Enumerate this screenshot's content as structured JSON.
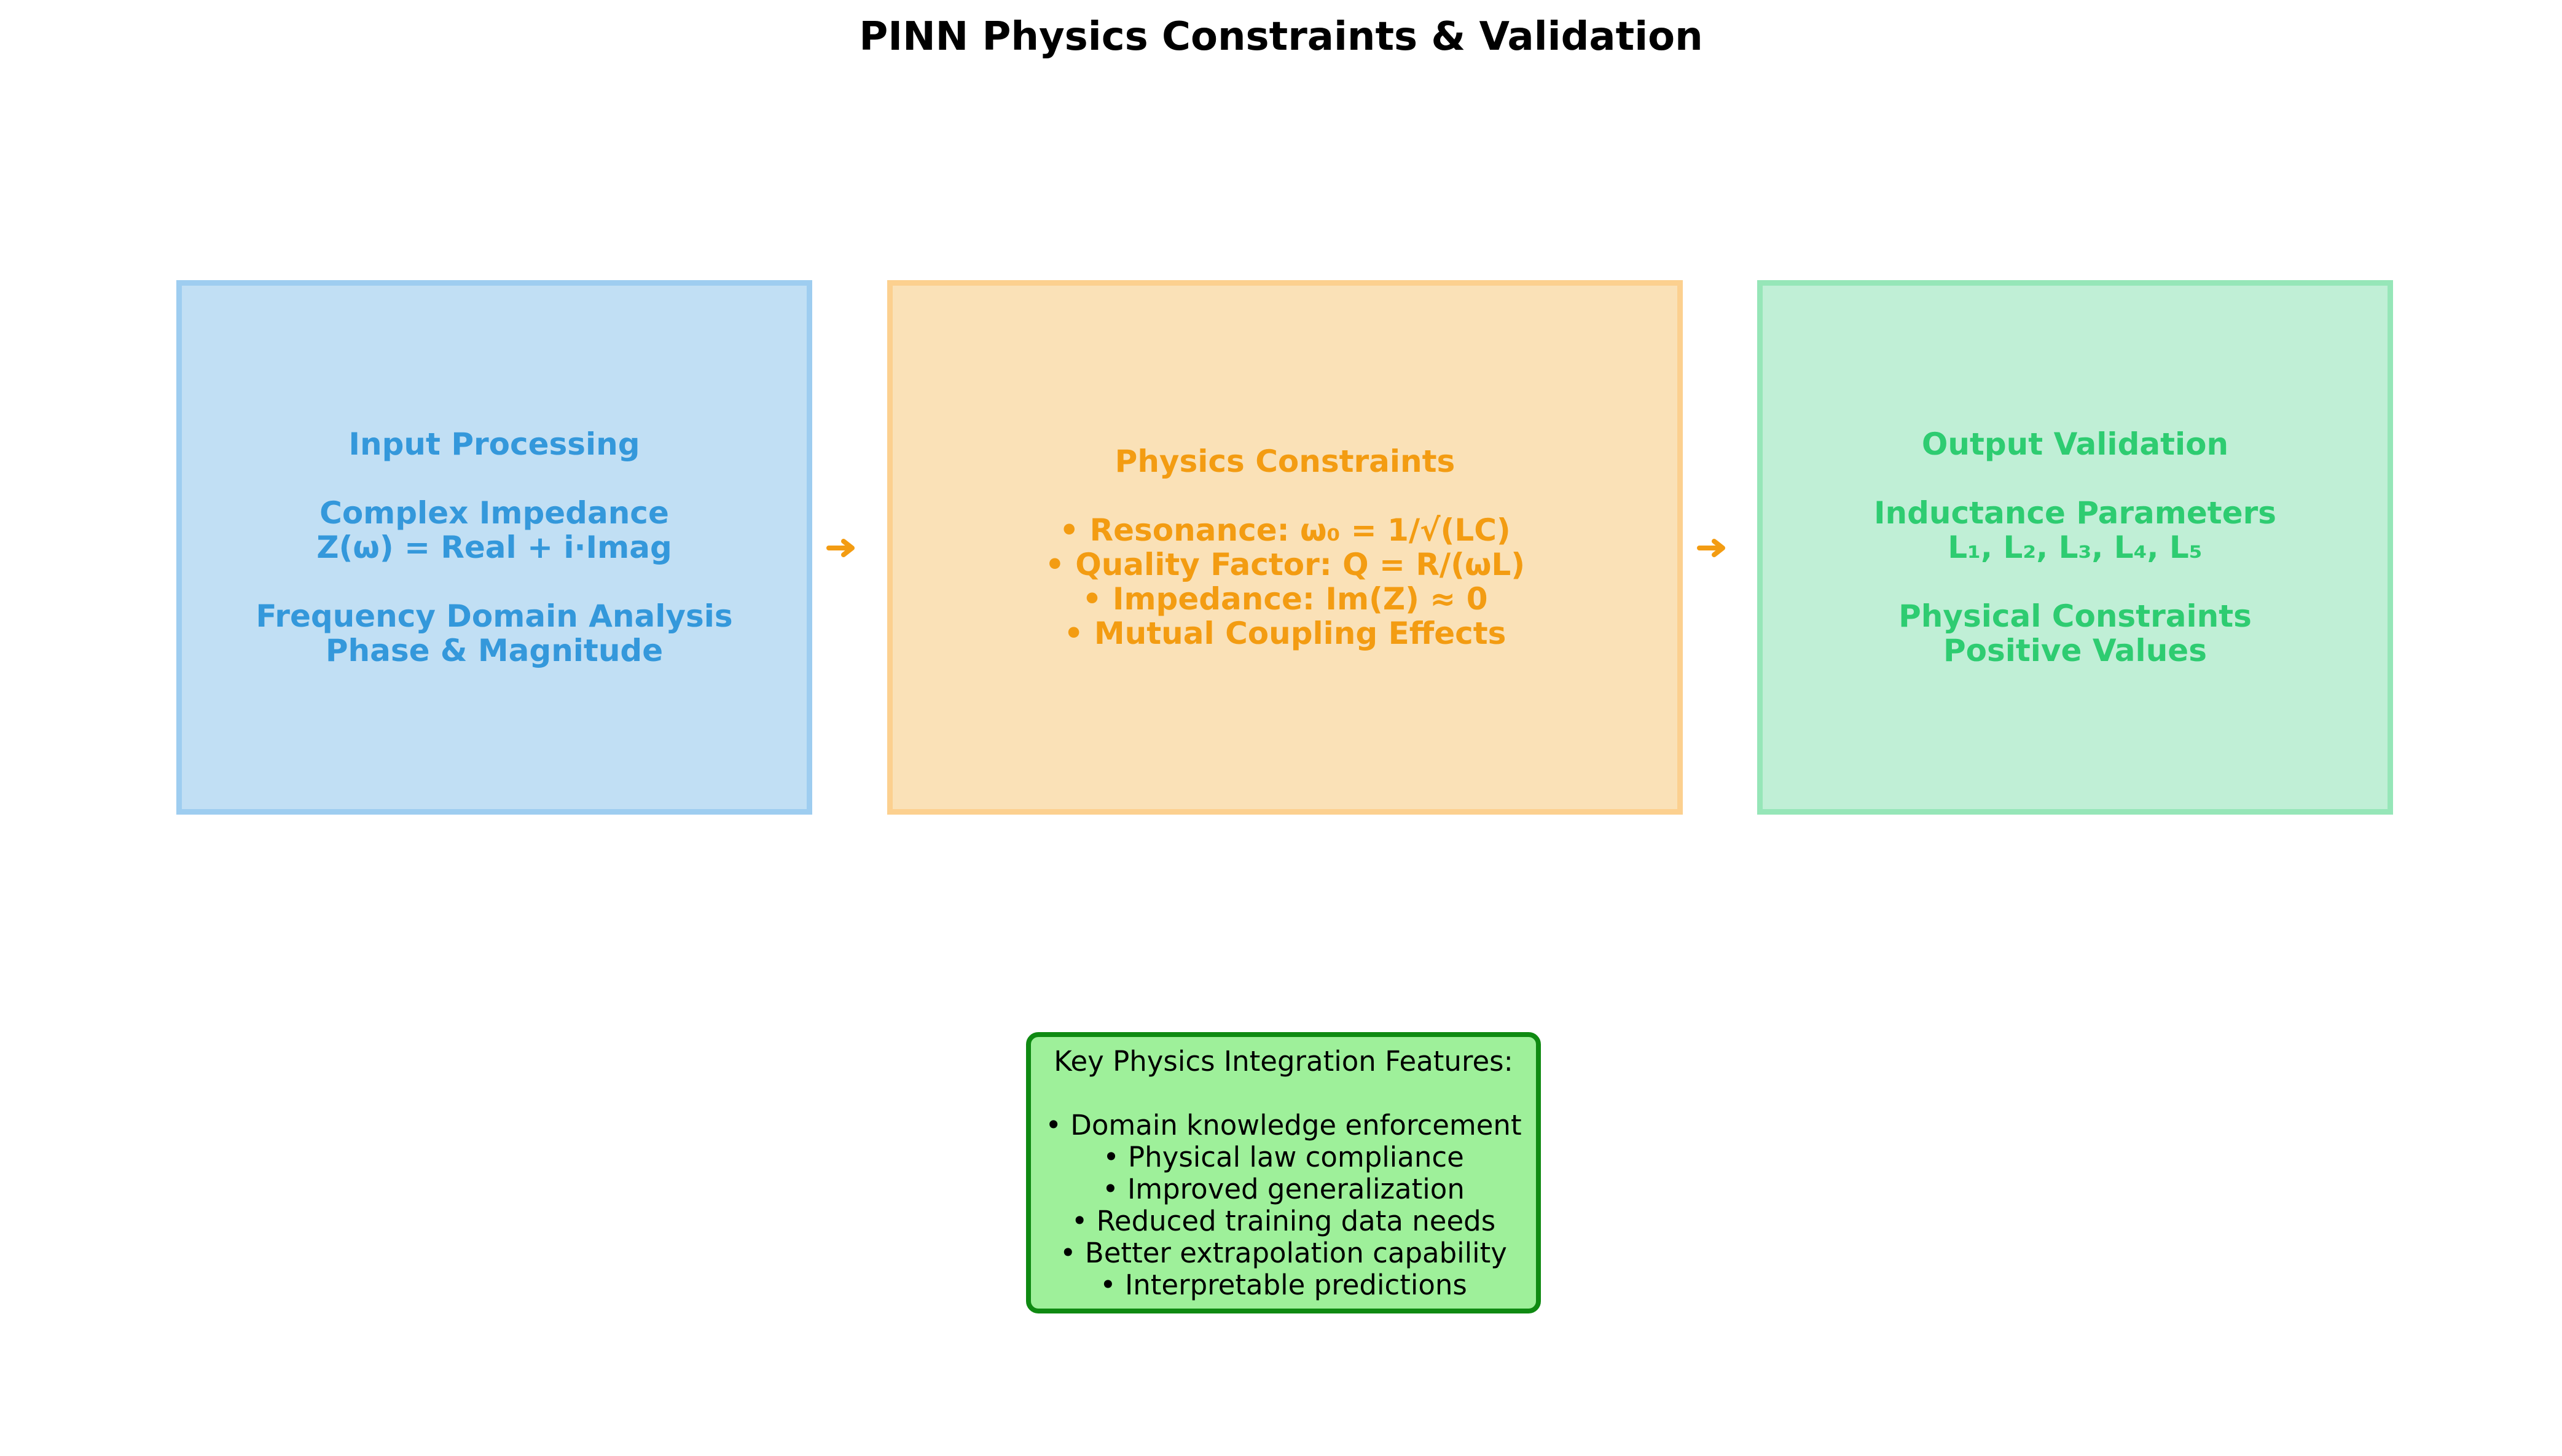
{
  "title": "PINN Physics Constraints & Validation",
  "colors": {
    "input": {
      "text": "#3498db",
      "fill": "#c1dff4",
      "border": "#9ecdf0"
    },
    "physics": {
      "text": "#f39c12",
      "fill": "#fae1b7",
      "border": "#fcd08f"
    },
    "output": {
      "text": "#2ecc71",
      "fill": "#c0efd6",
      "border": "#96e6b8"
    },
    "arrow": "#f39c12",
    "features_fill": "#9ef09a",
    "features_border": "#0f8a12"
  },
  "boxes": [
    {
      "heading": "Input Processing",
      "paragraphs": [
        [
          "Complex Impedance",
          "Z(ω) = Real + i·Imag"
        ],
        [
          "Frequency Domain Analysis",
          "Phase & Magnitude"
        ]
      ]
    },
    {
      "heading": "Physics Constraints",
      "paragraphs": [
        [
          "• Resonance: ω₀ = 1/√(LC)",
          "• Quality Factor: Q = R/(ωL)",
          "• Impedance: Im(Z) ≈ 0",
          "• Mutual Coupling Effects"
        ]
      ]
    },
    {
      "heading": "Output Validation",
      "paragraphs": [
        [
          "Inductance Parameters",
          "L₁, L₂, L₃, L₄, L₅"
        ],
        [
          "Physical Constraints",
          "Positive Values"
        ]
      ]
    }
  ],
  "features": {
    "title": "Key Physics Integration Features:",
    "items": [
      "• Domain knowledge enforcement",
      "• Physical law compliance",
      "• Improved generalization",
      "• Reduced training data needs",
      "• Better extrapolation capability",
      "• Interpretable predictions"
    ]
  }
}
